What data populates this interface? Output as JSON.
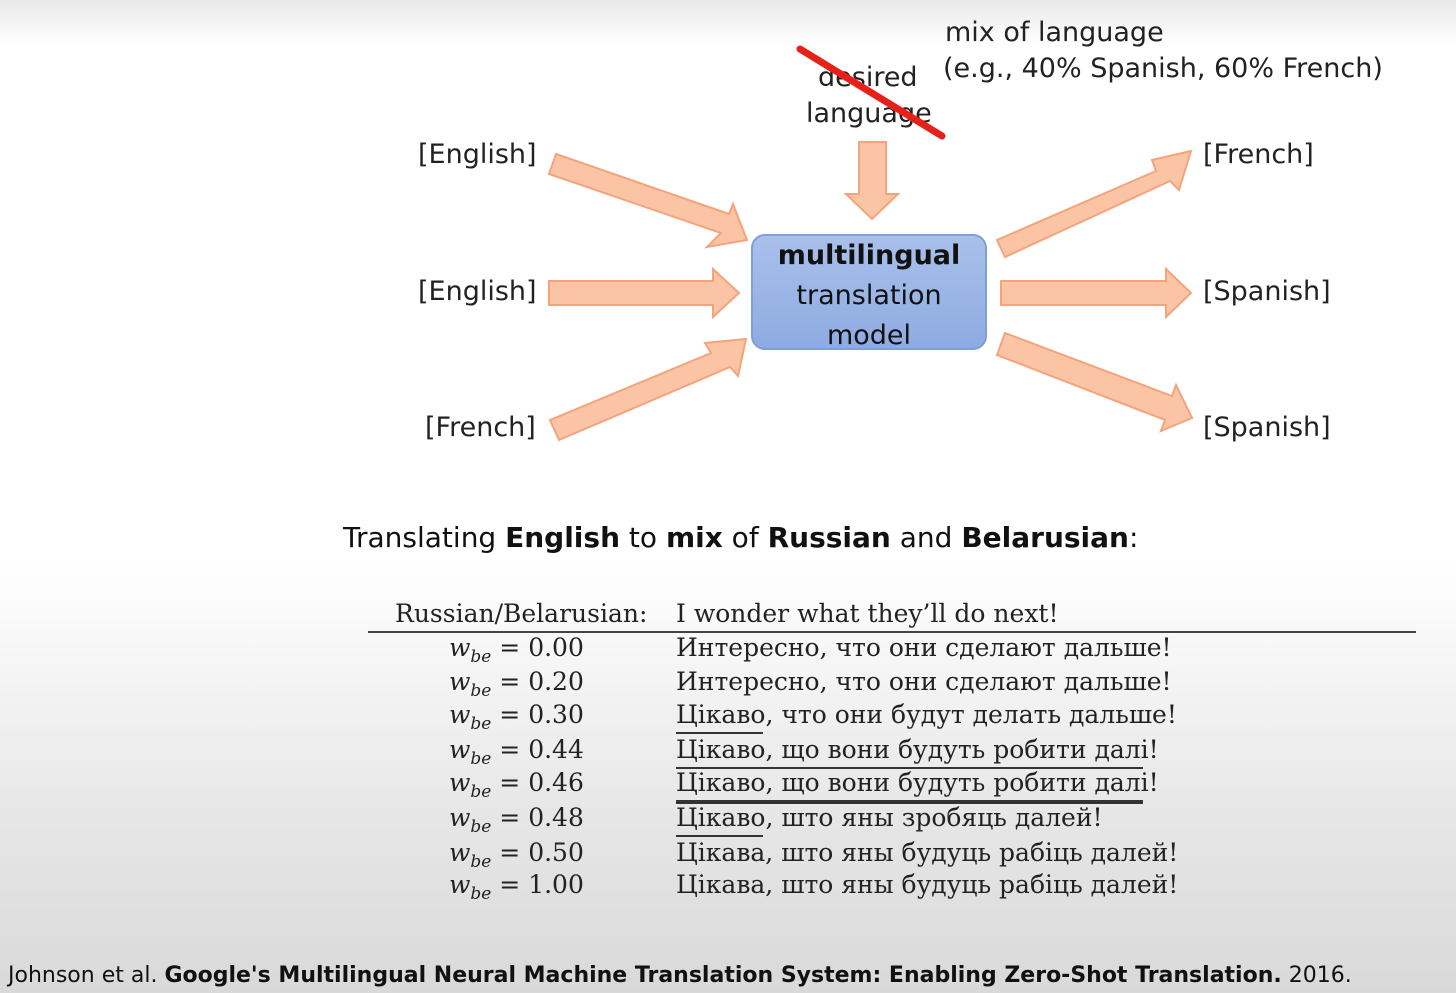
{
  "diagram": {
    "inputs": [
      "[English]",
      "[English]",
      "[French]"
    ],
    "outputs": [
      "[French]",
      "[Spanish]",
      "[Spanish]"
    ],
    "model_lines": [
      "multilingual",
      "translation",
      "model"
    ],
    "struck_label_lines": [
      "desired",
      "language"
    ],
    "mix_note_lines": [
      "mix of language",
      "(e.g., 40% Spanish, 60% French)"
    ],
    "colors": {
      "arrow_fill": "#fbc4a5",
      "arrow_stroke": "#f4a47c",
      "model_fill": "#9fb8e8",
      "strike": "#e8201a"
    }
  },
  "heading": {
    "p1": "Translating ",
    "b1": "English",
    "p2": " to ",
    "b2": "mix",
    "p3": " of ",
    "b3": "Russian",
    "p4": " and ",
    "b4": "Belarusian",
    "p5": ":"
  },
  "table": {
    "col1_header": "Russian/Belarusian:",
    "col2_header": "I wonder what they’ll do next!",
    "w_symbol": "w",
    "w_subscript": "be",
    "rows": [
      {
        "w": "= 0.00",
        "text": "Интересно, что они сделают дальше!"
      },
      {
        "w": "= 0.20",
        "text": "Интересно, что они сделают дальше!"
      },
      {
        "w": "= 0.30",
        "text": "Цікаво, что они будут делать дальше!"
      },
      {
        "w": "= 0.44",
        "text": "Цікаво, що вони будуть робити далі!"
      },
      {
        "w": "= 0.46",
        "text": "Цікаво, що вони будуть робити далі!"
      },
      {
        "w": "= 0.48",
        "text": "Цікаво, што яны зробяць далей!"
      },
      {
        "w": "= 0.50",
        "text": "Цікава, што яны будуць рабіць далей!"
      },
      {
        "w": "= 1.00",
        "text": "Цікава, што яны будуць рабіць далей!"
      }
    ]
  },
  "citation": {
    "authors": "Johnson et al. ",
    "title": "Google's Multilingual Neural Machine Translation System: Enabling Zero-Shot Translation.",
    "year": " 2016."
  }
}
